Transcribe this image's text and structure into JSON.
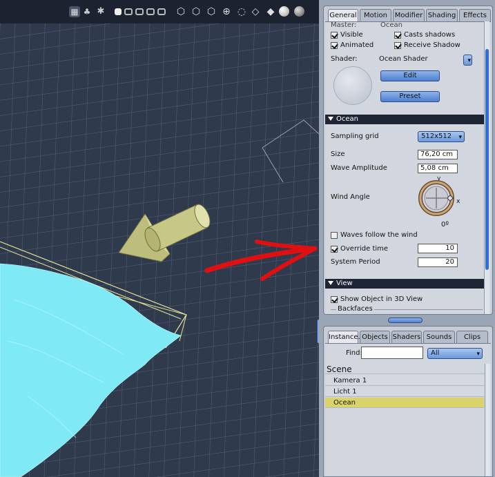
{
  "props": {
    "tabs": [
      "General",
      "Motion",
      "Modifier",
      "Shading",
      "Effects"
    ],
    "master_label": "Master:",
    "master_value": "Ocean",
    "visible_label": "Visible",
    "casts_shadows_label": "Casts shadows",
    "animated_label": "Animated",
    "receive_shadow_label": "Receive Shadow",
    "shader_label": "Shader:",
    "shader_value": "Ocean Shader",
    "edit_label": "Edit",
    "preset_label": "Preset",
    "ocean_section": "Ocean",
    "sampling_grid_label": "Sampling grid",
    "sampling_grid_value": "512x512",
    "size_label": "Size",
    "size_value": "76,20 cm",
    "wave_amplitude_label": "Wave Amplitude",
    "wave_amplitude_value": "5,08 cm",
    "wind_angle_label": "Wind Angle",
    "wind_y": "y",
    "wind_x": "x",
    "wind_angle_value": "0º",
    "waves_follow_label": "Waves follow the wind",
    "override_time_label": "Override time",
    "override_time_value": "10",
    "system_period_label": "System Period",
    "system_period_value": "20",
    "view_section": "View",
    "show_object_label": "Show Object in 3D View",
    "backfaces_label": "Backfaces",
    "checks": {
      "visible": true,
      "casts_shadows": true,
      "animated": true,
      "receive_shadow": true,
      "waves_follow": false,
      "override_time": true,
      "show_object": true
    }
  },
  "scene": {
    "tabs": [
      "Instance.",
      "Objects",
      "Shaders",
      "Sounds",
      "Clips"
    ],
    "find_label": "Find:",
    "find_value": "",
    "filter_value": "All",
    "scene_title": "Scene",
    "items": [
      "Kamera 1",
      "Licht 1",
      "Ocean"
    ],
    "selected": "Ocean"
  },
  "colors": {
    "water": "#7fe9f5",
    "selection": "#d9d36a",
    "arrow_annotation": "#e01010",
    "accent": "#4e7fcf"
  },
  "icons": [
    "pointer-select-icon",
    "scene-tree-icon",
    "render-icon",
    "view-layout-single-icon",
    "view-layout-split-icon",
    "rotate-icon",
    "move-icon",
    "scale-icon",
    "sphere-shaded-icon",
    "sphere-textured-icon"
  ]
}
